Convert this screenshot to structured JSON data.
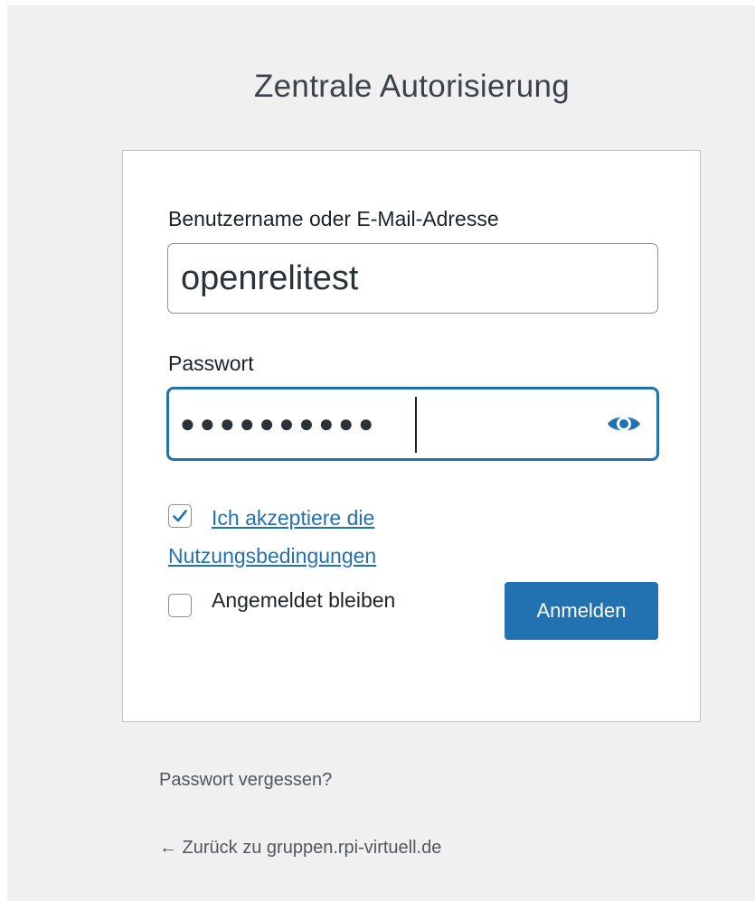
{
  "header": {
    "title": "Zentrale Autorisierung"
  },
  "login_form": {
    "username_label": "Benutzername oder E-Mail-Adresse",
    "username_value": "openrelitest",
    "password_label": "Passwort",
    "password_masked": "●●●●●●●●●●",
    "password_toggle_icon": "eye-icon",
    "terms_checkbox_checked": true,
    "terms_link_text": "Ich akzeptiere die Nutzungsbedingungen",
    "remember_checkbox_checked": false,
    "remember_label": "Angemeldet bleiben",
    "submit_label": "Anmelden"
  },
  "footer_links": {
    "lost_password": "Passwort vergessen?",
    "back_to_site": "← Zurück zu gruppen.rpi-virtuell.de"
  },
  "colors": {
    "page_background": "#f0f0f1",
    "accent": "#2271b1",
    "text": "#1d2327"
  }
}
